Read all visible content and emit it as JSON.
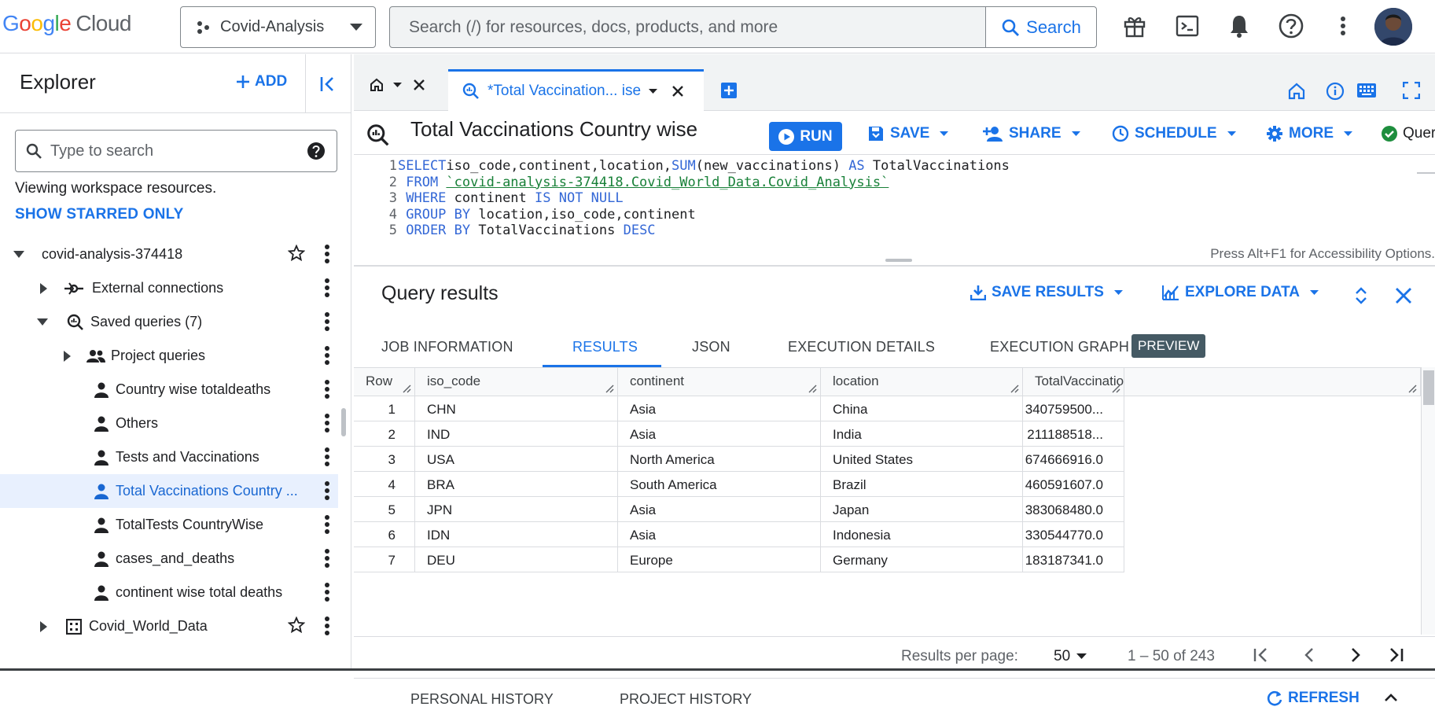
{
  "header": {
    "logo": {
      "google": "Google",
      "cloud": "Cloud"
    },
    "project": "Covid-Analysis",
    "search": {
      "placeholder": "Search (/) for resources, docs, products, and more",
      "button": "Search"
    },
    "icons": [
      "gift-icon",
      "terminal-icon",
      "bell-icon",
      "help-icon",
      "more-vert-icon",
      "avatar"
    ]
  },
  "explorer": {
    "title": "Explorer",
    "add_label": "ADD",
    "search_placeholder": "Type to search",
    "viewing_text": "Viewing workspace resources.",
    "starred_link": "SHOW STARRED ONLY",
    "tree": {
      "project": "covid-analysis-374418",
      "external": "External connections",
      "saved": "Saved queries (7)",
      "project_queries": "Project queries",
      "queries": [
        "Country wise totaldeaths",
        "Others",
        "Tests and Vaccinations",
        "Total Vaccinations Country ...",
        "TotalTests CountryWise",
        "cases_and_deaths",
        "continent wise total deaths"
      ],
      "dataset": "Covid_World_Data"
    }
  },
  "editor_tab": {
    "label": "*Total Vaccination... ise"
  },
  "query": {
    "title": "Total Vaccinations Country wise",
    "run": "RUN",
    "save": "SAVE",
    "share": "SHARE",
    "schedule": "SCHEDULE",
    "more": "MORE",
    "status": "Quer",
    "lines": [
      {
        "n": "1",
        "parts": [
          [
            "kw",
            "SELECT"
          ],
          [
            "",
            "iso_code,continent,location,"
          ],
          [
            "fn",
            "SUM"
          ],
          [
            "",
            "(new_vaccinations) "
          ],
          [
            "kw",
            "AS"
          ],
          [
            "",
            " TotalVaccinations"
          ]
        ]
      },
      {
        "n": "2",
        "parts": [
          [
            "kw",
            " FROM "
          ],
          [
            "str",
            "`covid-analysis-374418.Covid_World_Data.Covid_Analysis`"
          ]
        ]
      },
      {
        "n": "3",
        "parts": [
          [
            "kw",
            " WHERE "
          ],
          [
            "",
            "continent "
          ],
          [
            "kw",
            "IS NOT NULL"
          ]
        ]
      },
      {
        "n": "4",
        "parts": [
          [
            "kw",
            " GROUP BY "
          ],
          [
            "",
            "location,iso_code,continent"
          ]
        ]
      },
      {
        "n": "5",
        "parts": [
          [
            "kw",
            " ORDER BY "
          ],
          [
            "",
            "TotalVaccinations "
          ],
          [
            "kw",
            "DESC"
          ]
        ]
      }
    ],
    "accessibility": "Press Alt+F1 for Accessibility Options."
  },
  "results": {
    "title": "Query results",
    "save_results": "SAVE RESULTS",
    "explore_data": "EXPLORE DATA",
    "tabs": [
      "JOB INFORMATION",
      "RESULTS",
      "JSON",
      "EXECUTION DETAILS",
      "EXECUTION GRAPH"
    ],
    "preview_badge": "PREVIEW",
    "columns": [
      "Row",
      "iso_code",
      "continent",
      "location",
      "TotalVaccination"
    ],
    "rows": [
      [
        "1",
        "CHN",
        "Asia",
        "China",
        "340759500..."
      ],
      [
        "2",
        "IND",
        "Asia",
        "India",
        "211188518..."
      ],
      [
        "3",
        "USA",
        "North America",
        "United States",
        "674666916.0"
      ],
      [
        "4",
        "BRA",
        "South America",
        "Brazil",
        "460591607.0"
      ],
      [
        "5",
        "JPN",
        "Asia",
        "Japan",
        "383068480.0"
      ],
      [
        "6",
        "IDN",
        "Asia",
        "Indonesia",
        "330544770.0"
      ],
      [
        "7",
        "DEU",
        "Europe",
        "Germany",
        "183187341.0"
      ]
    ],
    "pager": {
      "label": "Results per page:",
      "per_page": "50",
      "range": "1 – 50 of 243"
    }
  },
  "history": {
    "personal": "PERSONAL HISTORY",
    "project": "PROJECT HISTORY",
    "refresh": "REFRESH"
  }
}
